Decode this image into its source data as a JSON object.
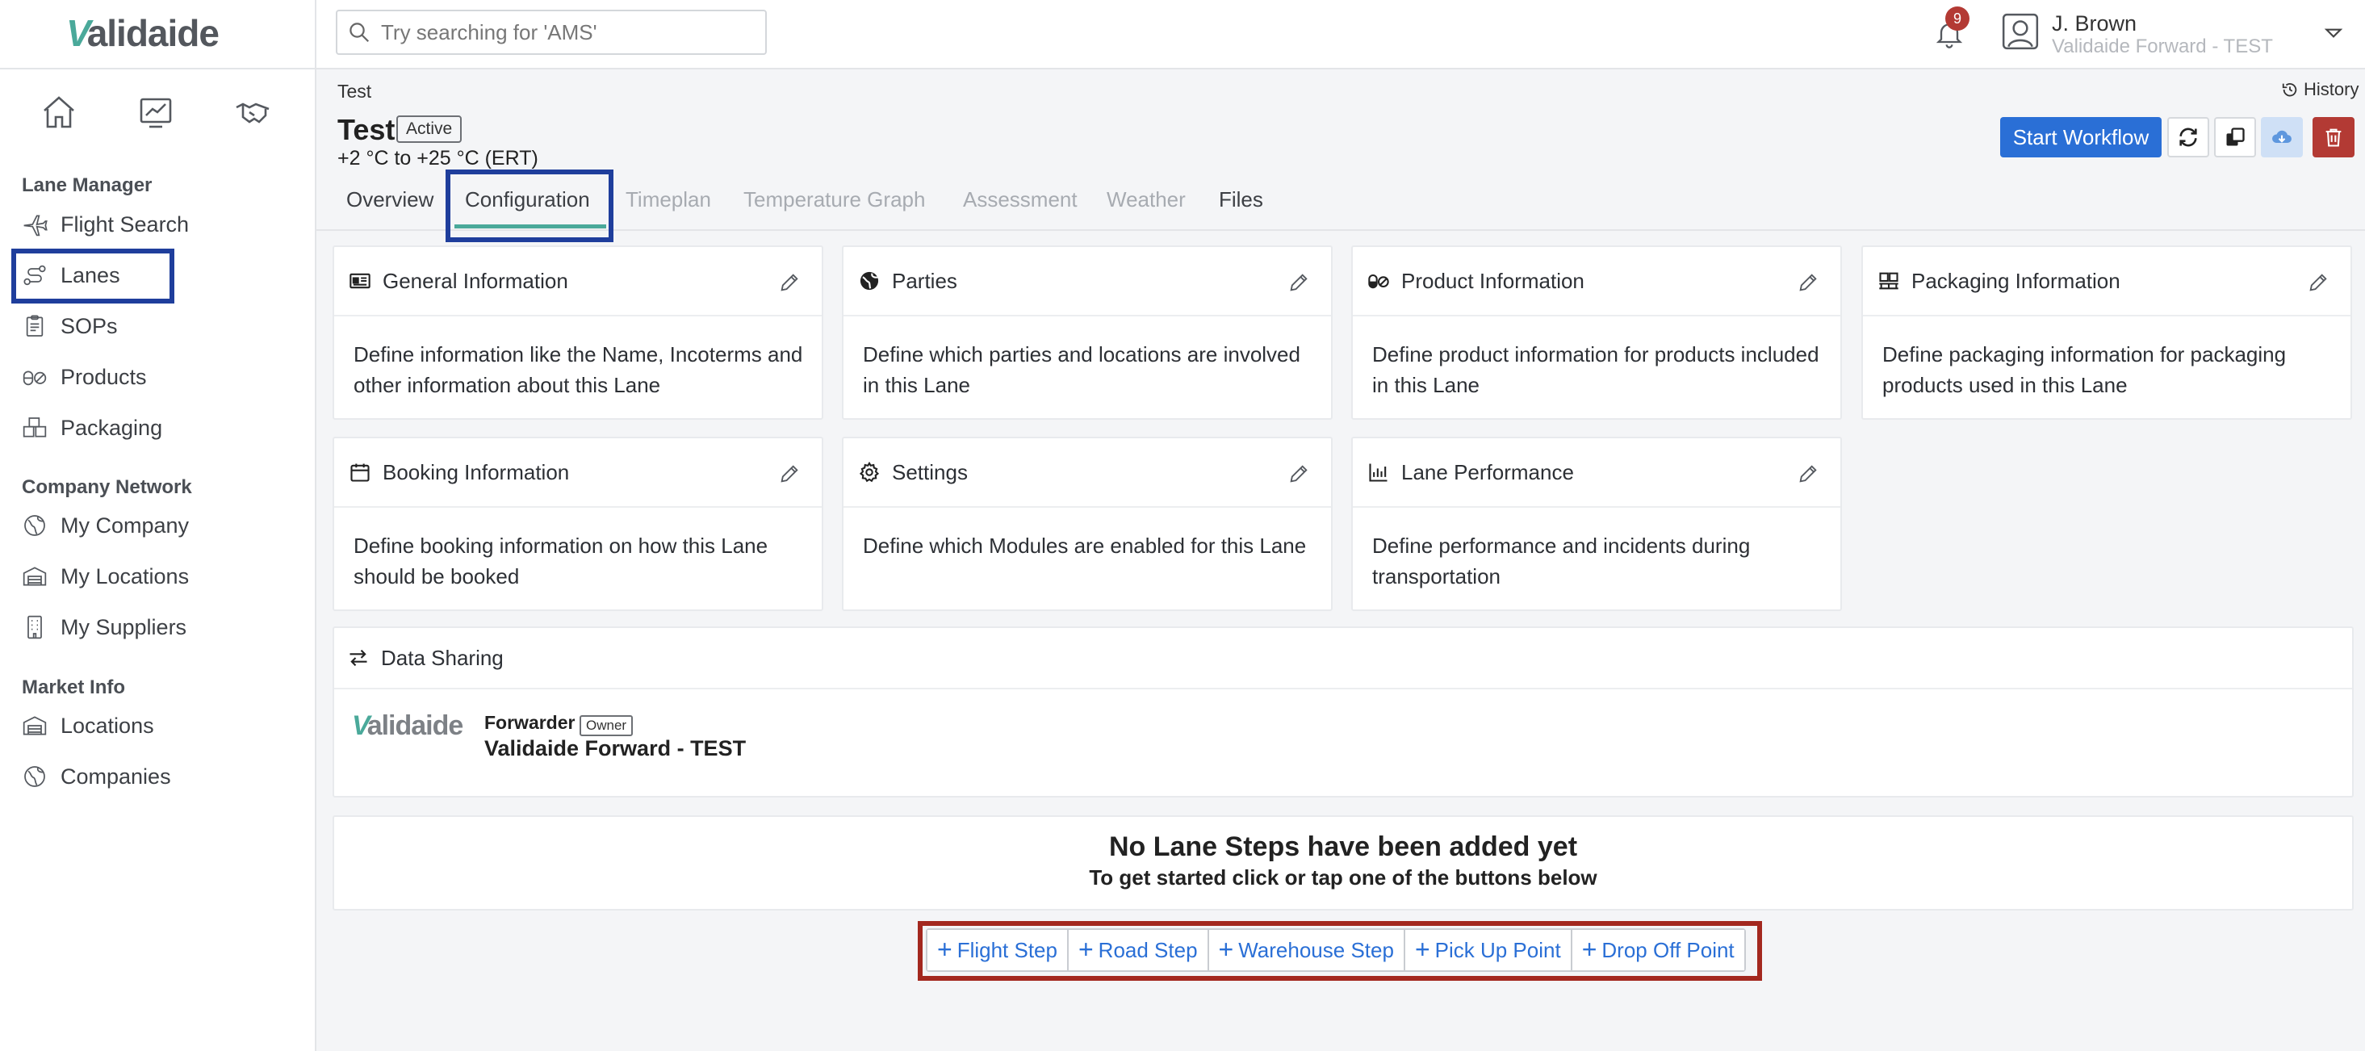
{
  "app": {
    "logo_text": "alidaide",
    "logo_v": "V"
  },
  "search": {
    "placeholder": "Try searching for 'AMS'"
  },
  "notifications": {
    "count": "9"
  },
  "user": {
    "name": "J. Brown",
    "org": "Validaide Forward - TEST"
  },
  "sidebar": {
    "quick_icons": [
      "home-icon",
      "chart-icon",
      "handshake-icon"
    ],
    "sections": {
      "lane_manager": "Lane Manager",
      "company_network": "Company Network",
      "market_info": "Market Info"
    },
    "items": {
      "flight_search": "Flight Search",
      "lanes": "Lanes",
      "sops": "SOPs",
      "products": "Products",
      "packaging": "Packaging",
      "my_company": "My Company",
      "my_locations": "My Locations",
      "my_suppliers": "My Suppliers",
      "locations": "Locations",
      "companies": "Companies"
    }
  },
  "header": {
    "breadcrumb": "Test",
    "history": "History",
    "title": "Test",
    "status": "Active",
    "temp_range": "+2 °C to +25 °C (ERT)",
    "start_workflow": "Start Workflow"
  },
  "tabs": {
    "overview": "Overview",
    "configuration": "Configuration",
    "timeplan": "Timeplan",
    "temperature_graph": "Temperature Graph",
    "assessment": "Assessment",
    "weather": "Weather",
    "files": "Files"
  },
  "cards": {
    "general": {
      "title": "General Information",
      "desc": "Define information like the Name, Incoterms and other information about this Lane"
    },
    "parties": {
      "title": "Parties",
      "desc": "Define which parties and locations are involved in this Lane"
    },
    "product": {
      "title": "Product Information",
      "desc": "Define product information for products included in this Lane"
    },
    "packaging": {
      "title": "Packaging Information",
      "desc": "Define packaging information for packaging products used in this Lane"
    },
    "booking": {
      "title": "Booking Information",
      "desc": "Define booking information on how this Lane should be booked"
    },
    "settings": {
      "title": "Settings",
      "desc": "Define which Modules are enabled for this Lane"
    },
    "performance": {
      "title": "Lane Performance",
      "desc": "Define performance and incidents during transportation"
    }
  },
  "data_sharing": {
    "title": "Data Sharing",
    "logo_text": "alidaide",
    "logo_v": "V",
    "role": "Forwarder",
    "owner_badge": "Owner",
    "company": "Validaide Forward - TEST"
  },
  "empty_state": {
    "title": "No Lane Steps have been added yet",
    "subtitle": "To get started click or tap one of the buttons below"
  },
  "step_buttons": {
    "flight": "Flight Step",
    "road": "Road Step",
    "warehouse": "Warehouse Step",
    "pickup": "Pick Up Point",
    "dropoff": "Drop Off Point"
  },
  "colors": {
    "primary": "#2a6fd6",
    "accent_teal": "#4aa99a",
    "highlight_blue": "#1f3e9c",
    "highlight_red": "#a3281f",
    "delete_red": "#b33a34"
  }
}
